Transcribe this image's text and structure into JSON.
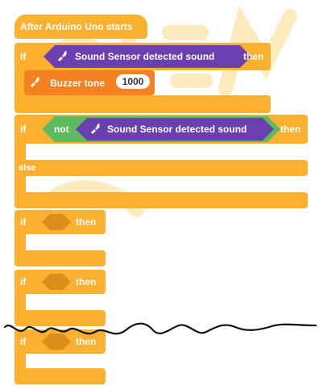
{
  "colors": {
    "control": "#fbb12f",
    "sensor": "#6b3fb0",
    "operator": "#5cba5f",
    "buzzer": "#f5801f",
    "watermark": "#fde5b0",
    "white": "#ffffff"
  },
  "hat_block": {
    "label": "After Arduino Uno starts"
  },
  "blocks": {
    "if1": {
      "if": "if",
      "sensor": "Sound Sensor detected sound",
      "then": "then"
    },
    "buzzer": {
      "label": "Buzzer tone",
      "value": "1000"
    },
    "if2": {
      "if": "if",
      "not": "not",
      "sensor": "Sound Sensor detected sound",
      "then": "then",
      "else": "else"
    },
    "if3": {
      "if": "if",
      "then": "then"
    },
    "if4": {
      "if": "if",
      "then": "then"
    },
    "if5": {
      "if": "if",
      "then": "then"
    }
  },
  "icons": {
    "sensor_icon": "plug-icon",
    "buzzer_icon": "plug-icon"
  }
}
